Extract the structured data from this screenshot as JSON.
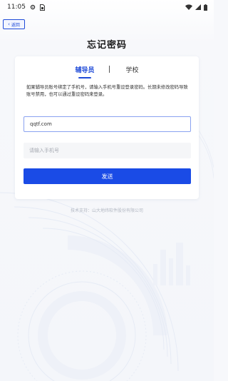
{
  "status_bar": {
    "time": "11:05",
    "icons": [
      "gear-icon",
      "sim-card-icon",
      "wifi-icon",
      "signal-icon",
      "battery-icon"
    ]
  },
  "back_button": {
    "label": "返回",
    "icon": "chevron-left-icon"
  },
  "page_title": "忘记密码",
  "tabs": [
    {
      "label": "辅导员",
      "active": true
    },
    {
      "label": "学校",
      "active": false
    }
  ],
  "hint": "如果辅导员账号绑定了手机号，请输入手机号重设登录密码。长期未修改密码导致账号禁用，也可以通过重设密码来登录。",
  "form": {
    "account_value": "qqtf.com",
    "phone_placeholder": "请输入手机号",
    "submit_label": "发送"
  },
  "footer": "技术支持：山大地纬软件股份有限公司",
  "colors": {
    "accent": "#1f4bd8",
    "button": "#1a4be6",
    "background": "#f4f6fa"
  }
}
